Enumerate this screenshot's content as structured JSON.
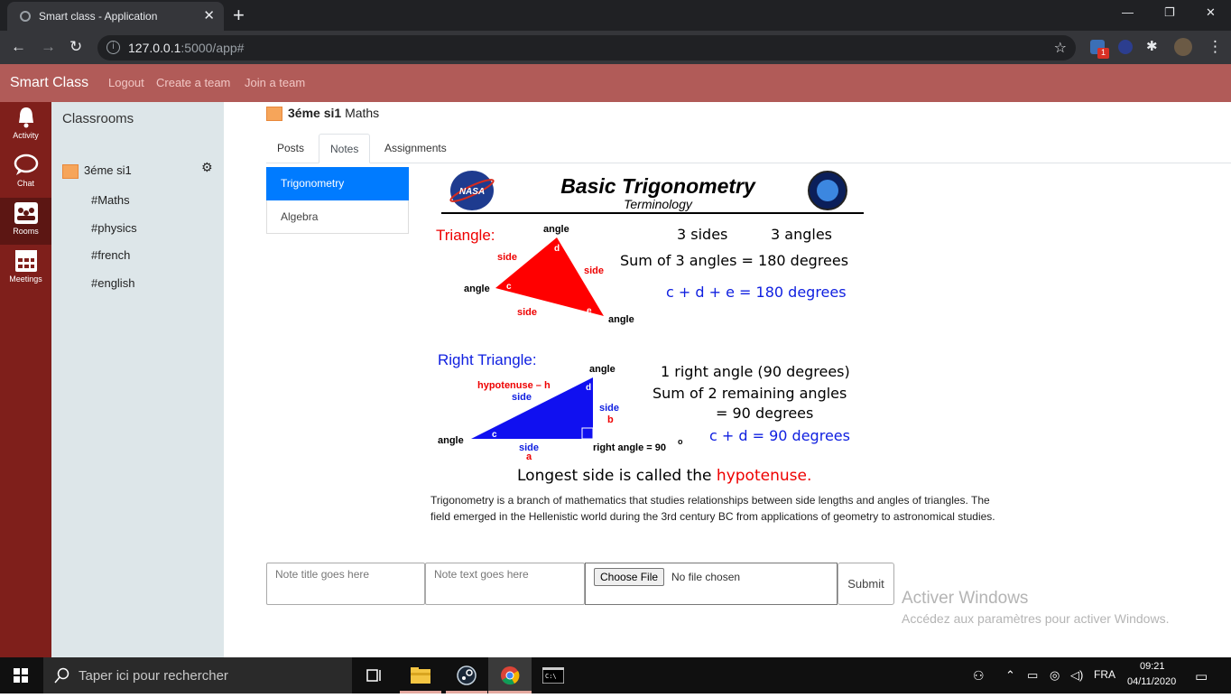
{
  "browser": {
    "tab_title": "Smart class - Application",
    "url_host": "127.0.0.1",
    "url_path": ":5000/app#",
    "ext_badge": "1"
  },
  "app": {
    "brand": "Smart Class",
    "nav": [
      "Logout",
      "Create a team",
      "Join a team"
    ]
  },
  "rail": [
    {
      "label": "Activity",
      "icon": "bell-icon"
    },
    {
      "label": "Chat",
      "icon": "chat-icon"
    },
    {
      "label": "Rooms",
      "icon": "rooms-icon"
    },
    {
      "label": "Meetings",
      "icon": "calendar-icon"
    }
  ],
  "sidebar": {
    "header": "Classrooms",
    "classroom": "3éme si1",
    "channels": [
      "#Maths",
      "#physics",
      "#french",
      "#english"
    ]
  },
  "main": {
    "room": "3éme si1",
    "channel": "Maths",
    "tabs": [
      "Posts",
      "Notes",
      "Assignments"
    ],
    "active_tab": "Notes",
    "notes": [
      "Trigonometry",
      "Algebra"
    ],
    "active_note": "Trigonometry",
    "note_body": "Trigonometry is a branch of mathematics that studies relationships between side lengths and angles of triangles. The field emerged in the Hellenistic world during the 3rd century BC from applications of geometry to astronomical studies.",
    "form": {
      "title_placeholder": "Note title goes here",
      "text_placeholder": "Note text goes here",
      "file_button": "Choose File",
      "file_status": "No file chosen",
      "submit": "Submit"
    }
  },
  "figure": {
    "title": "Basic Trigonometry",
    "subtitle": "Terminology",
    "nasa": "NASA",
    "triangle_label": "Triangle:",
    "tri_facts": [
      "3 sides",
      "3 angles",
      "Sum of 3 angles  =  180 degrees"
    ],
    "tri_eq": "c + d + e = 180 degrees",
    "right_label": "Right Triangle:",
    "right_facts": [
      "1 right angle (90 degrees)",
      "Sum of 2 remaining angles",
      "= 90 degrees"
    ],
    "right_eq": "c + d = 90 degrees",
    "hyp_label": "hypotenuse  – h",
    "word_angle": "angle",
    "word_side": "side",
    "right_angle_text": "right  angle = 90",
    "degree_mark": "o",
    "letters": [
      "c",
      "d",
      "e",
      "a",
      "b"
    ],
    "longest_prefix": "Longest side is called the ",
    "longest_word": "hypotenuse."
  },
  "watermark": {
    "line1": "Activer Windows",
    "line2": "Accédez aux paramètres pour activer Windows."
  },
  "taskbar": {
    "search": "Taper ici pour rechercher",
    "lang": "FRA",
    "time": "09:21",
    "date": "04/11/2020"
  }
}
